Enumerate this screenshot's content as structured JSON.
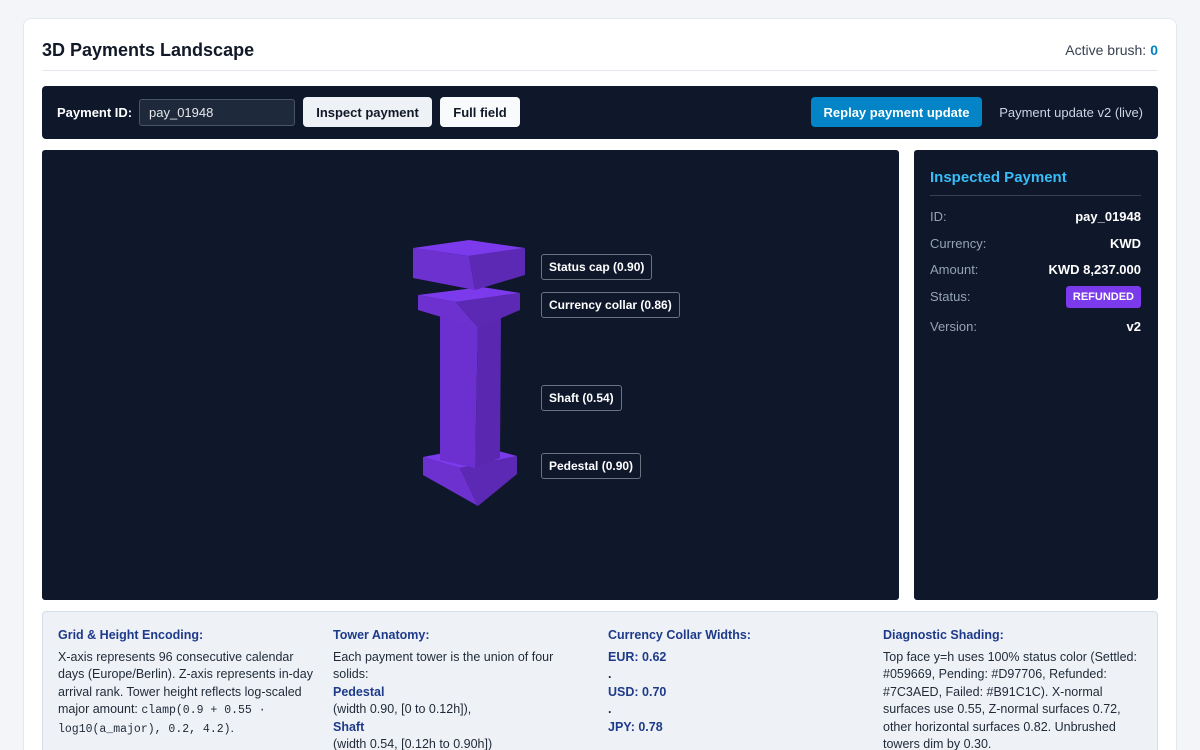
{
  "header": {
    "title": "3D Payments Landscape",
    "brush_label": "Active brush:",
    "brush_value": "0"
  },
  "toolbar": {
    "id_label": "Payment ID:",
    "id_value": "pay_01948",
    "inspect_label": "Inspect payment",
    "full_field_label": "Full field",
    "replay_label": "Replay payment update",
    "status_text": "Payment update v2 (live)"
  },
  "scene": {
    "tower_color": "#7C3AED",
    "labels": {
      "cap": "Status cap (0.90)",
      "collar": "Currency collar (0.86)",
      "shaft": "Shaft (0.54)",
      "pedestal": "Pedestal (0.90)"
    }
  },
  "inspected": {
    "title": "Inspected Payment",
    "rows": [
      {
        "key": "ID:",
        "value": "pay_01948"
      },
      {
        "key": "Currency:",
        "value": "KWD"
      },
      {
        "key": "Amount:",
        "value": "KWD 8,237.000"
      },
      {
        "key": "Status:",
        "value": "REFUNDED"
      },
      {
        "key": "Version:",
        "value": "v2"
      }
    ],
    "status_color": "#7C3AED"
  },
  "legend": {
    "grid": {
      "title": "Grid & Height Encoding:",
      "text": "X-axis represents 96 consecutive calendar days (Europe/Berlin). Z-axis represents in-day arrival rank. Tower height reflects log-scaled major amount:",
      "formula": "clamp(0.9 + 0.55 · log10(a_major), 0.2, 4.2)",
      "tail": "."
    },
    "anatomy": {
      "title": "Tower Anatomy:",
      "intro": "Each payment tower is the union of four solids:",
      "p1_name": "Pedestal",
      "p1_desc": "(width 0.90, [0 to 0.12h]),",
      "p2_name": "Shaft",
      "p2_desc": "(width 0.54, [0.12h to 0.90h])"
    },
    "collar": {
      "title": "Currency Collar Widths:",
      "eur": "EUR: 0.62",
      "usd": "USD: 0.70",
      "jpy": "JPY: 0.78",
      "sep": "."
    },
    "shading": {
      "title": "Diagnostic Shading:",
      "text": "Top face y=h uses 100% status color (Settled: #059669, Pending: #D97706, Refunded: #7C3AED, Failed: #B91C1C). X-normal surfaces use 0.55, Z-normal surfaces 0.72, other horizontal surfaces 0.82. Unbrushed towers dim by 0.30."
    }
  }
}
